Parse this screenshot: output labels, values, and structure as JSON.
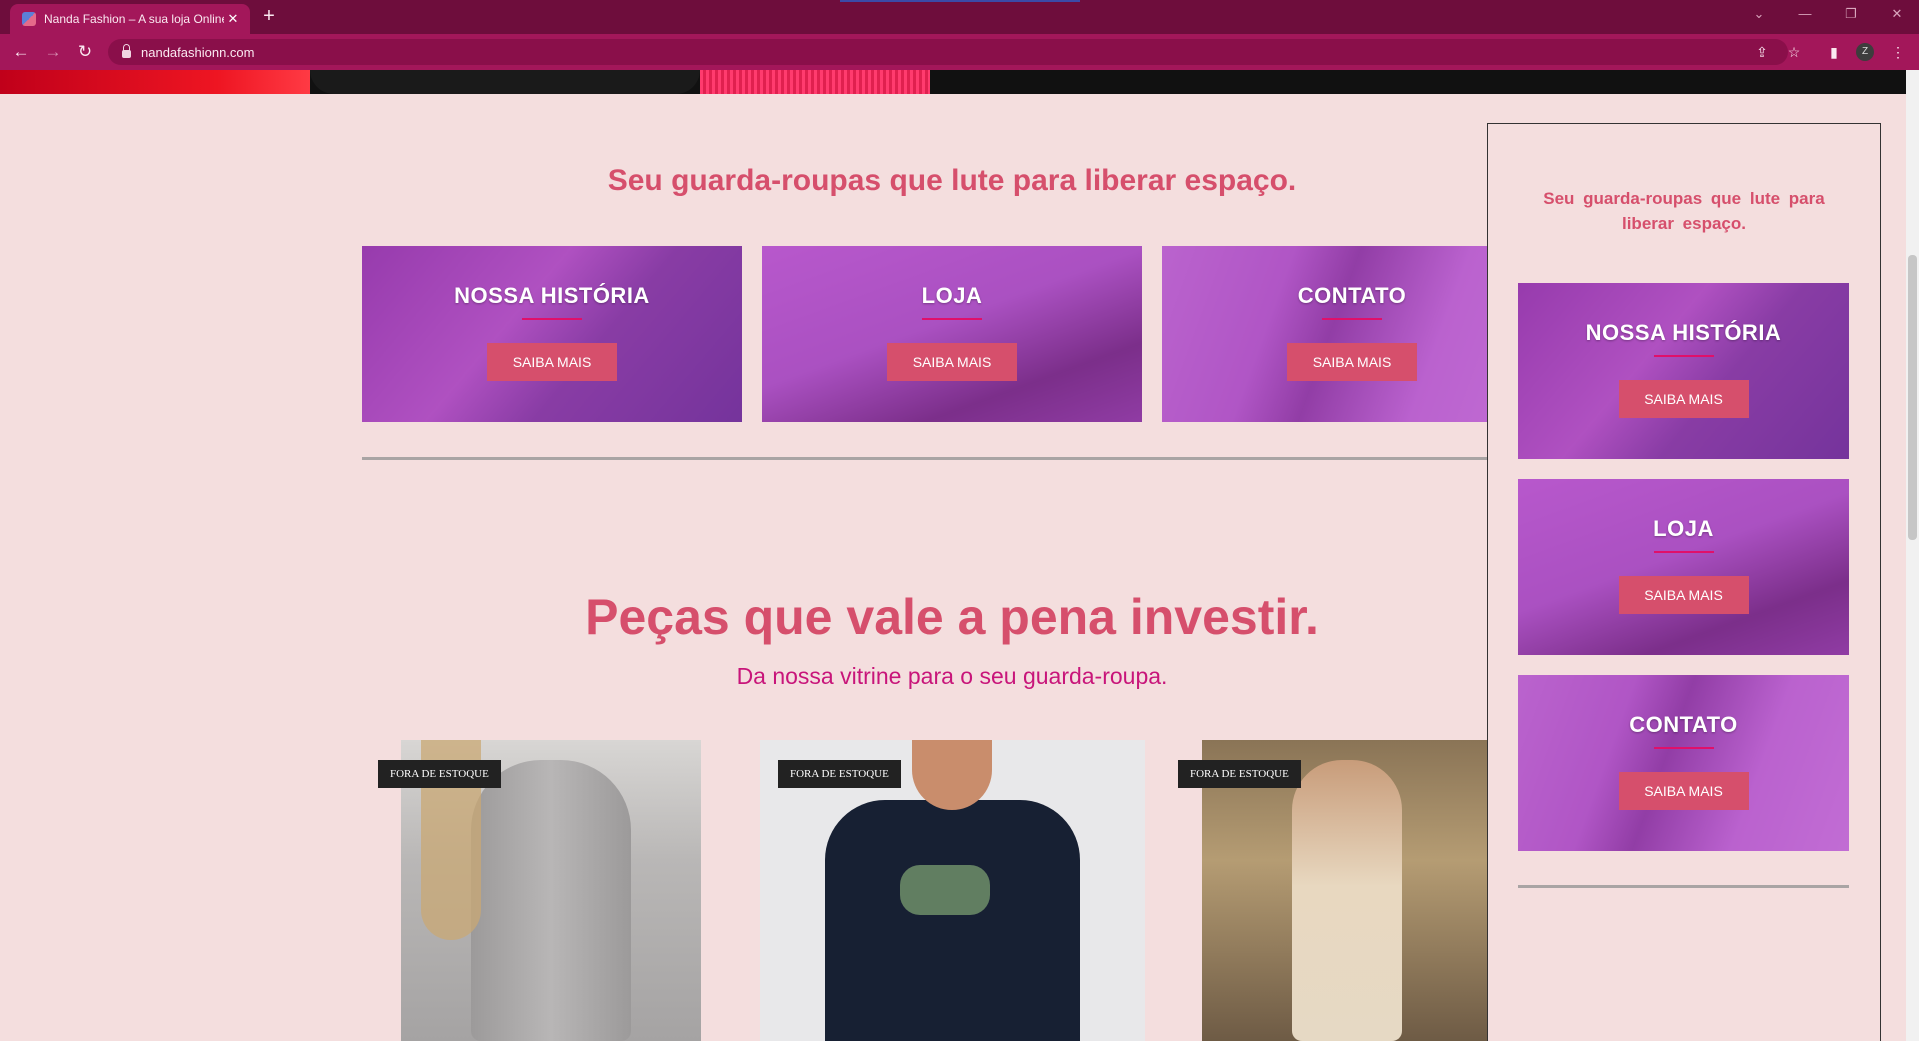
{
  "browser": {
    "tab_title": "Nanda Fashion – A sua loja Online",
    "tab_close": "✕",
    "new_tab": "+",
    "url": "nandafashionn.com",
    "profile_initial": "Z",
    "icons": [
      "back-icon",
      "forward-icon",
      "reload-icon",
      "lock-icon",
      "share-icon",
      "star-icon",
      "sidepanel-icon",
      "menu-icon"
    ]
  },
  "section_categories": {
    "heading": "Seu guarda-roupas que lute para liberar espaço.",
    "cards": [
      {
        "title": "NOSSA HISTÓRIA",
        "button": "SAIBA MAIS"
      },
      {
        "title": "LOJA",
        "button": "SAIBA MAIS"
      },
      {
        "title": "CONTATO",
        "button": "SAIBA MAIS"
      }
    ]
  },
  "section_products": {
    "heading": "Peças que vale a pena investir.",
    "subheading": "Da nossa vitrine para o seu guarda-roupa.",
    "products": [
      {
        "badge": "FORA DE ESTOQUE"
      },
      {
        "badge": "FORA DE ESTOQUE"
      },
      {
        "badge": "FORA DE ESTOQUE"
      }
    ]
  },
  "panel": {
    "heading": "Seu guarda-roupas que lute para liberar espaço.",
    "cards": [
      {
        "title": "NOSSA HISTÓRIA",
        "button": "SAIBA MAIS"
      },
      {
        "title": "LOJA",
        "button": "SAIBA MAIS"
      },
      {
        "title": "CONTATO",
        "button": "SAIBA MAIS"
      }
    ]
  },
  "colors": {
    "page_bg": "#f4dede",
    "accent": "#d64f6c",
    "browser_frame": "#a3175a",
    "card_overlay": "#af3cc8"
  }
}
